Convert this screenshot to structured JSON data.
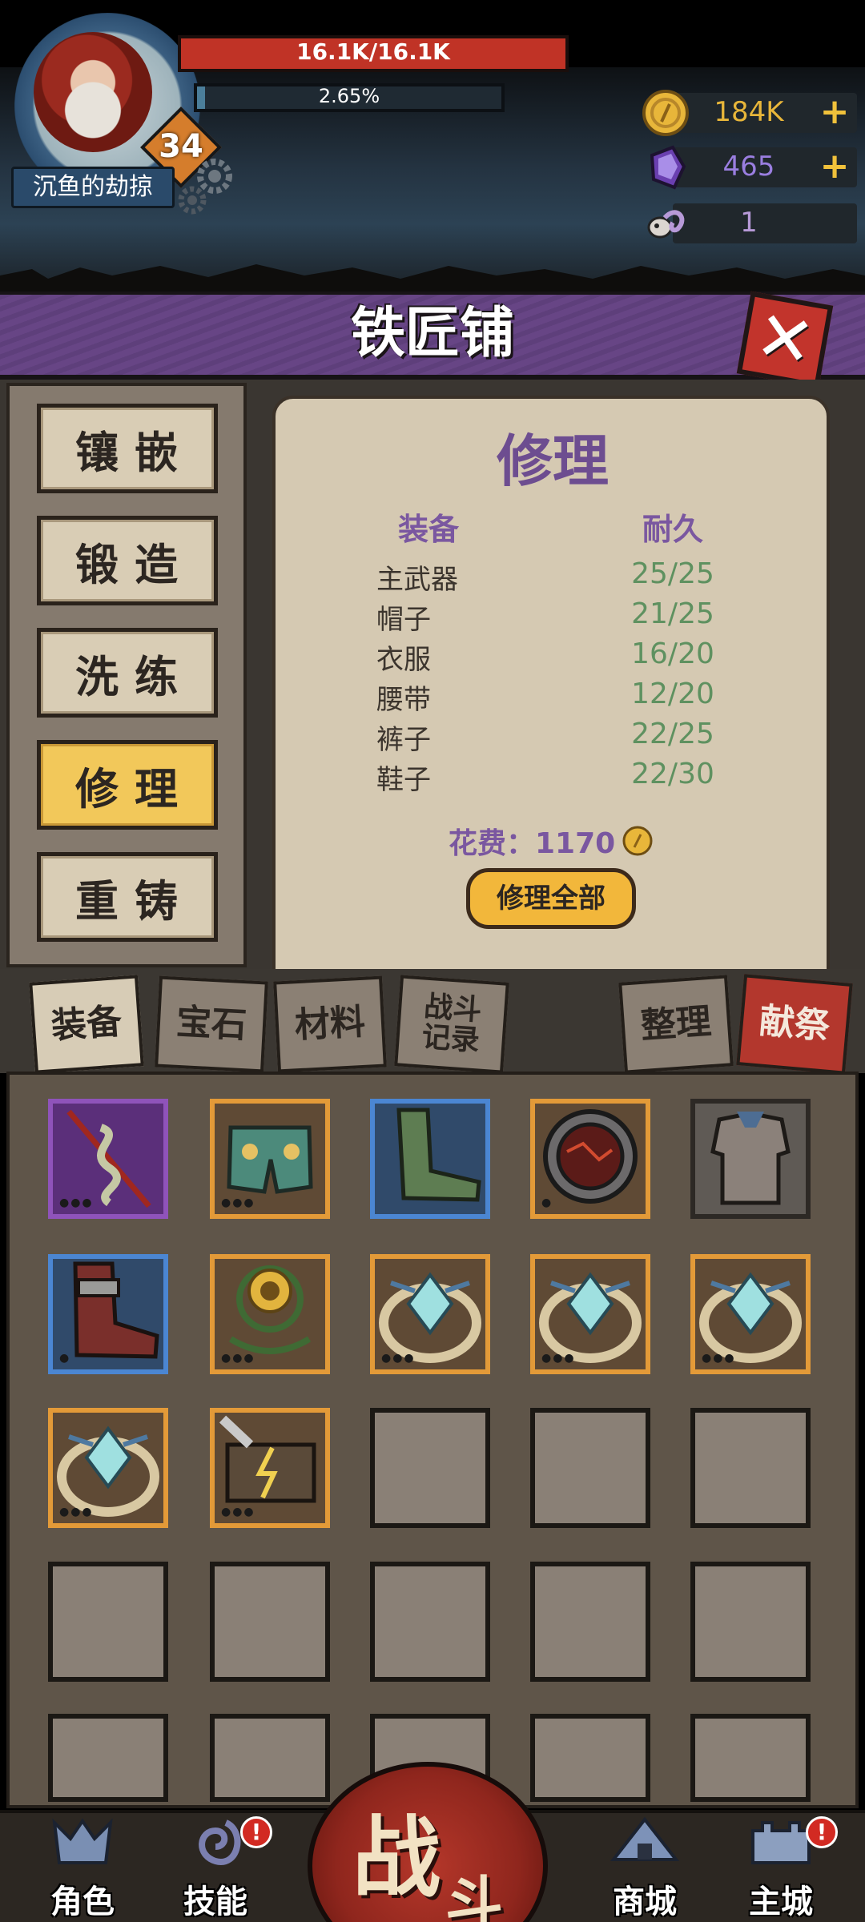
{
  "player": {
    "name": "沉鱼的劫掠",
    "level": "34",
    "hp_text": "16.1K/16.1K",
    "hp_fraction": 1.0,
    "xp_text": "2.65%",
    "xp_fraction": 0.0265
  },
  "currencies": [
    {
      "icon": "gold-coin-icon",
      "value": "184K",
      "color": "#e8b63a",
      "has_plus": true,
      "plus": "+"
    },
    {
      "icon": "purple-crystal-icon",
      "value": "465",
      "color": "#9a7ee0",
      "has_plus": true,
      "plus": "+"
    },
    {
      "icon": "ram-skull-icon",
      "value": "1",
      "color": "#b79ad8",
      "has_plus": false
    }
  ],
  "title": "铁匠铺",
  "close_icon": "close-x-icon",
  "side_menu": [
    {
      "label": "镶嵌",
      "active": false
    },
    {
      "label": "锻造",
      "active": false
    },
    {
      "label": "洗练",
      "active": false
    },
    {
      "label": "修理",
      "active": true
    },
    {
      "label": "重铸",
      "active": false
    }
  ],
  "repair": {
    "heading": "修理",
    "col_equip": "装备",
    "col_durability": "耐久",
    "rows": [
      {
        "name": "主武器",
        "durability": "25/25"
      },
      {
        "name": "帽子",
        "durability": "21/25"
      },
      {
        "name": "衣服",
        "durability": "16/20"
      },
      {
        "name": "腰带",
        "durability": "12/20"
      },
      {
        "name": "裤子",
        "durability": "22/25"
      },
      {
        "name": "鞋子",
        "durability": "22/30"
      }
    ],
    "cost_label": "花费：1170",
    "repair_all_label": "修理全部"
  },
  "inventory_tabs": [
    {
      "label": "装备",
      "active": true
    },
    {
      "label": "宝石",
      "active": false
    },
    {
      "label": "材料",
      "active": false
    },
    {
      "label": "战斗记录",
      "active": false
    }
  ],
  "sort_label": "整理",
  "sacrifice_label": "献祭",
  "inventory": [
    {
      "rarity": "purple",
      "icon": "serpent-spear-icon",
      "dots": "●●●"
    },
    {
      "rarity": "orange",
      "icon": "shorts-icon",
      "dots": "●●●"
    },
    {
      "rarity": "blue",
      "icon": "green-boots-icon",
      "dots": ""
    },
    {
      "rarity": "orange",
      "icon": "lava-shield-icon",
      "dots": "●"
    },
    {
      "rarity": "gray",
      "icon": "tattered-shirt-icon",
      "dots": ""
    },
    {
      "rarity": "blue",
      "icon": "leather-boots-icon",
      "dots": "●"
    },
    {
      "rarity": "orange",
      "icon": "sunflower-belt-icon",
      "dots": "●●●"
    },
    {
      "rarity": "orange",
      "icon": "ice-dragon-ring-icon",
      "dots": "●●●"
    },
    {
      "rarity": "orange",
      "icon": "ice-dragon-ring-icon",
      "dots": "●●●"
    },
    {
      "rarity": "orange",
      "icon": "ice-dragon-ring-icon",
      "dots": "●●●"
    },
    {
      "rarity": "orange",
      "icon": "ice-dragon-ring-icon",
      "dots": "●●●"
    },
    {
      "rarity": "orange",
      "icon": "lightning-cleaver-icon",
      "dots": "●●●"
    }
  ],
  "nav": {
    "character": "角色",
    "skills": "技能",
    "battle_1": "战",
    "battle_2": "斗",
    "shop": "商城",
    "city": "主城",
    "alert": "!"
  }
}
